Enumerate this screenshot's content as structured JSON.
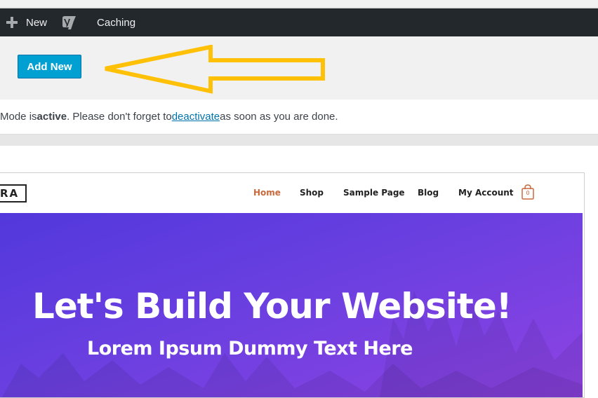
{
  "admin_bar": {
    "new_label": "New",
    "caching_label": "Caching",
    "icons": [
      "plus-icon",
      "yoast-icon"
    ],
    "background": "#23282d"
  },
  "header": {
    "add_new_label": "Add New",
    "button_color": "#00a0d2",
    "annotation_color": "#ffc107"
  },
  "notice": {
    "prefix": "Mode is ",
    "active_word": "active",
    "middle": ". Please don't forget to ",
    "link_text": "deactivate",
    "suffix": " as soon as you are done."
  },
  "site": {
    "logo_text": "RA",
    "nav": [
      "Home",
      "Shop",
      "Sample Page",
      "Blog",
      "My Account"
    ],
    "active_nav": "Home",
    "cart_count": "0",
    "accent_color": "#c9693c",
    "hero_title": "Let's Build Your Website!",
    "hero_subtitle": "Lorem Ipsum Dummy Text Here"
  }
}
